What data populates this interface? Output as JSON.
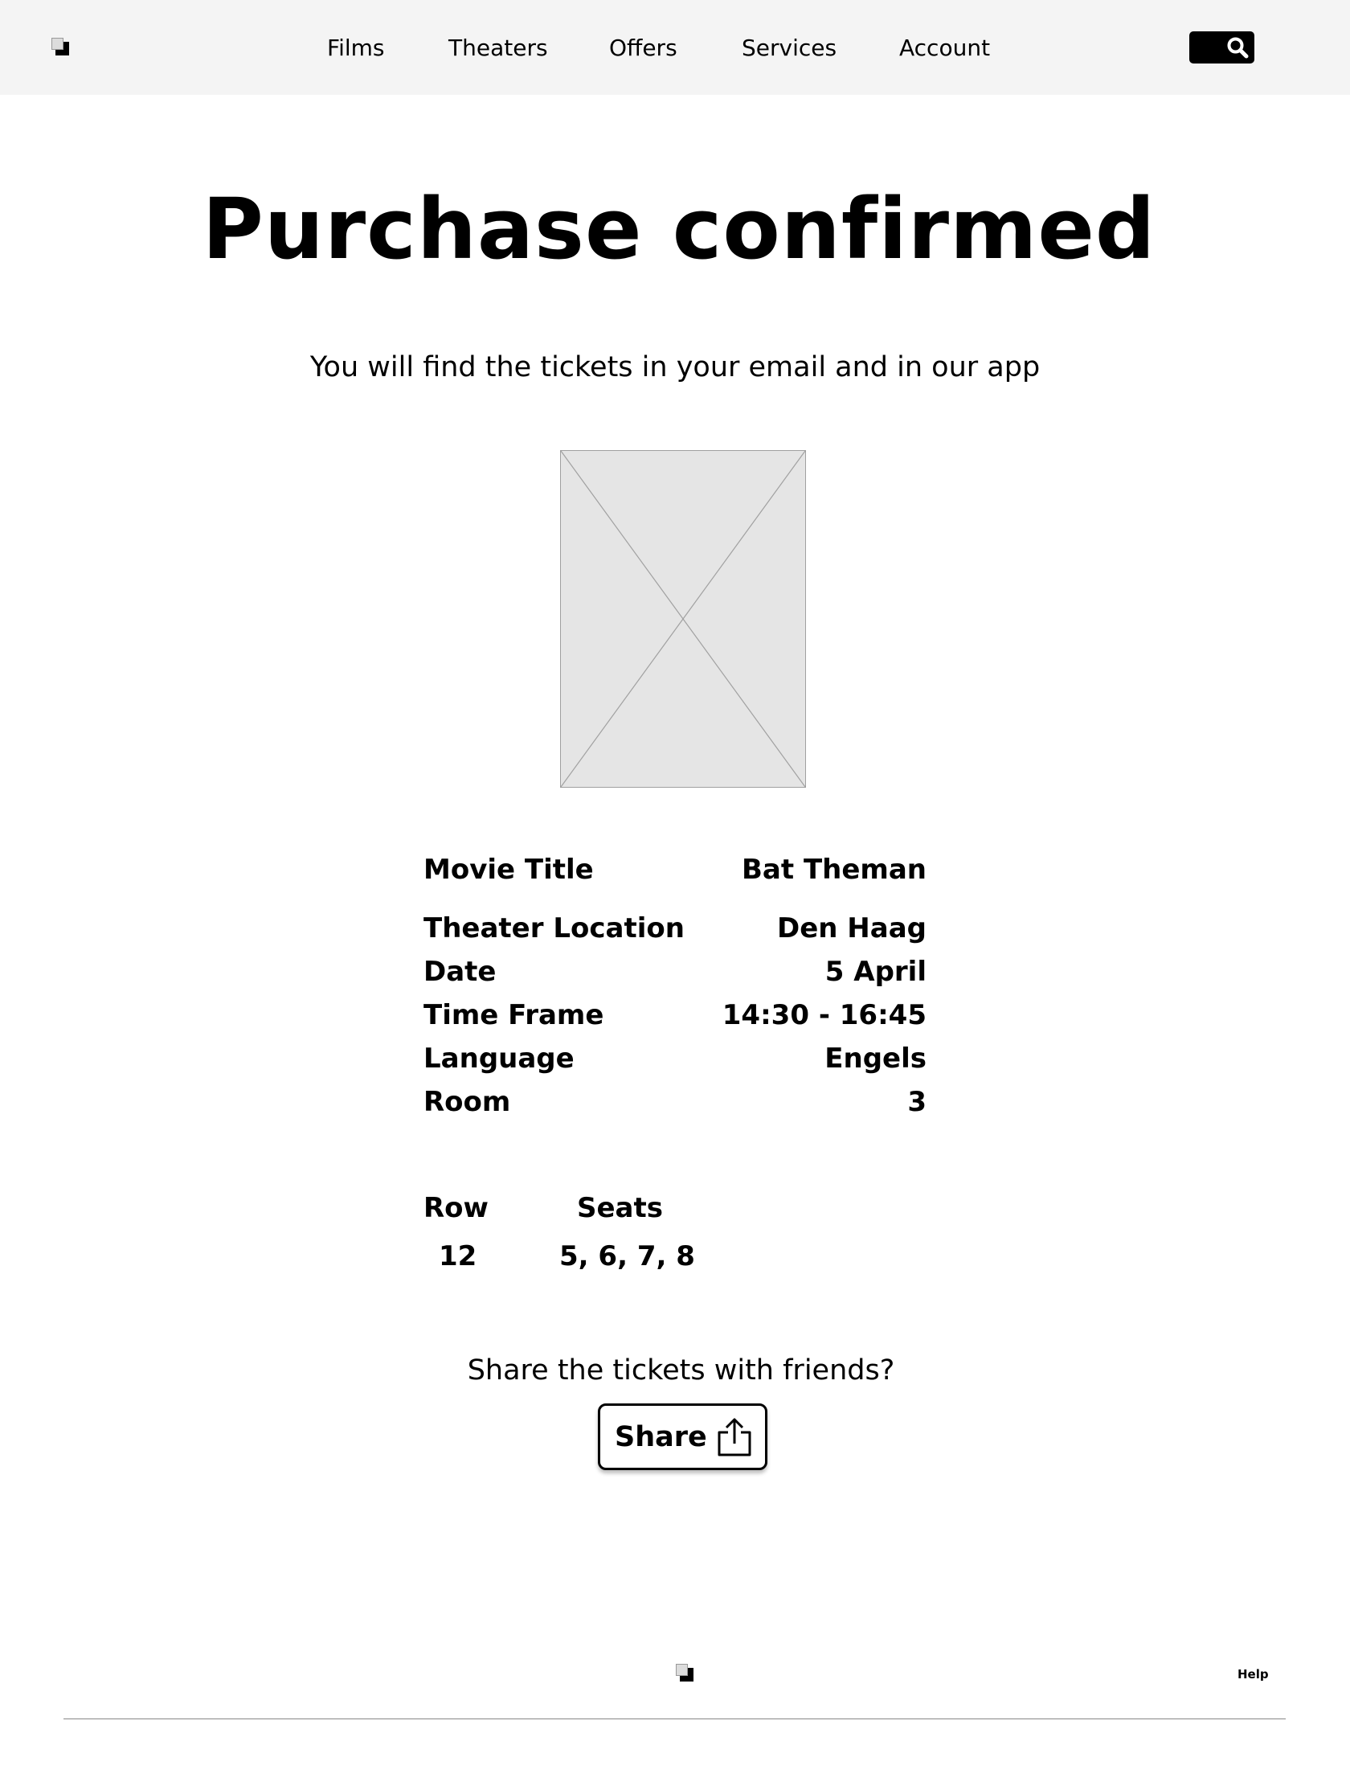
{
  "header": {
    "logo_icon": "app-logo-icon",
    "nav": [
      {
        "label": "Films"
      },
      {
        "label": "Theaters"
      },
      {
        "label": "Offers"
      },
      {
        "label": "Services"
      },
      {
        "label": "Account"
      }
    ],
    "search_icon": "search-icon"
  },
  "main": {
    "title": "Purchase confirmed",
    "subtitle": "You will find the tickets in your email and in our app",
    "poster_icon": "image-placeholder-icon",
    "details": [
      {
        "label": "Movie Title",
        "value": "Bat Theman"
      },
      {
        "label": "Theater Location",
        "value": "Den Haag"
      },
      {
        "label": "Date",
        "value": "5 April"
      },
      {
        "label": "Time Frame",
        "value": "14:30 - 16:45"
      },
      {
        "label": "Language",
        "value": "Engels"
      },
      {
        "label": "Room",
        "value": "3"
      }
    ],
    "seating": {
      "row_label": "Row",
      "row_value": "12",
      "seats_label": "Seats",
      "seats_value": "5, 6, 7, 8"
    },
    "share_question": "Share the tickets with friends?",
    "share_label": "Share",
    "share_icon": "share-icon"
  },
  "footer": {
    "logo_icon": "app-logo-icon",
    "help_label": "Help"
  },
  "colors": {
    "header_bg": "#f4f4f4",
    "text": "#000000",
    "placeholder_bg": "#e5e5e5"
  }
}
